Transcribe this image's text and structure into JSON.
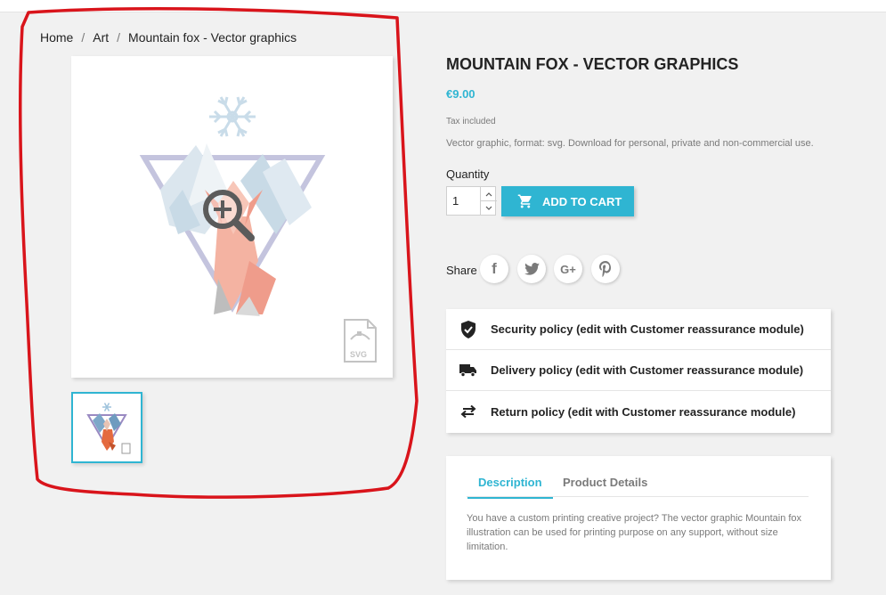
{
  "breadcrumb": {
    "items": [
      "Home",
      "Art",
      "Mountain fox - Vector graphics"
    ],
    "separator": "/"
  },
  "product": {
    "title": "MOUNTAIN FOX - VECTOR GRAPHICS",
    "price": "€9.00",
    "tax": "Tax included",
    "short_description": "Vector graphic, format: svg. Download for personal, private and non-commercial use.",
    "image_badge": "SVG",
    "image_icons": [
      "snowflake-icon",
      "zoom-in-icon",
      "svg-file-icon"
    ]
  },
  "purchase": {
    "quantity_label": "Quantity",
    "quantity_value": "1",
    "add_to_cart_label": "ADD TO CART"
  },
  "share": {
    "label": "Share",
    "networks": [
      "facebook",
      "twitter",
      "google-plus",
      "pinterest"
    ],
    "glyphs": [
      "f",
      "",
      "G+",
      ""
    ]
  },
  "reassurance": {
    "items": [
      {
        "icon": "shield-check-icon",
        "text": "Security policy (edit with Customer reassurance module)"
      },
      {
        "icon": "truck-icon",
        "text": "Delivery policy (edit with Customer reassurance module)"
      },
      {
        "icon": "swap-arrows-icon",
        "text": "Return policy (edit with Customer reassurance module)"
      }
    ]
  },
  "tabs": {
    "items": [
      "Description",
      "Product Details"
    ],
    "active": "Description",
    "content": "You have a custom printing creative project? The vector graphic Mountain fox illustration can be used for printing purpose on any support, without size limitation."
  },
  "colors": {
    "accent": "#2fb5d2",
    "text": "#232323",
    "muted": "#7a7a7a",
    "annotation": "#d9141b",
    "background": "#f1f1f1"
  }
}
